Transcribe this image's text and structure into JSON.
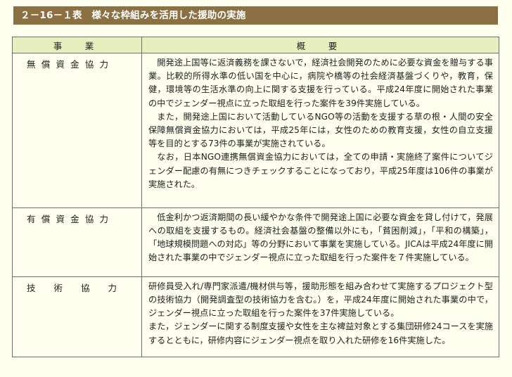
{
  "title": "２－16－１表　様々な枠組みを活用した援助の実施",
  "table": {
    "headers": [
      "事　業",
      "概　要"
    ],
    "rows": [
      {
        "category": "無償資金協力",
        "paragraphs": [
          "開発途上国等に返済義務を課さないで，経済社会開発のために必要な資金を贈与する事業。比較的所得水準の低い国を中心に，病院や橋等の社会経済基盤づくりや，教育，保健，環境等の生活水準の向上に関する支援を行っている。平成24年度に開始された事業の中でジェンダー視点に立った取組を行った案件を39件実施している。",
          "また，開発途上国において活動しているNGO等の活動を支援する草の根・人間の安全保障無償資金協力においては，平成25年には，女性のための教育支援，女性の自立支援等を目的とする73件の事業が実施されている。",
          "なお，日本NGO連携無償資金協力においては，全ての申請・実施終了案件についてジェンダー配慮の有無につきチェックすることになっており，平成25年度は106件の事業が実施された。"
        ]
      },
      {
        "category": "有償資金協力",
        "paragraphs": [
          "低金利かつ返済期間の長い緩やかな条件で開発途上国に必要な資金を貸し付けて，発展への取組を支援するもの。経済社会基盤の整備以外にも，「貧困削減」，「平和の構築」，「地球規模問題への対応」等の分野において事業を実施している。JICAは平成24年度に開始された事業の中でジェンダー視点に立った取組を行った案件を７件実施している。"
        ]
      },
      {
        "category": "技術協力",
        "paragraphs": [
          "研修員受入れ/専門家派遣/機材供与等，援助形態を組み合わせて実施するプロジェクト型の技術協力（開発調査型の技術協力を含む。）を，平成24年度に開始された事業の中で，ジェンダー視点に立った取組を行った案件を37件実施している。",
          "また，ジェンダーに関する制度支援や女性を主な裨益対象とする集団研修24コースを実施するとともに，研修内容にジェンダー視点を取り入れた研修を16件実施した。"
        ]
      }
    ]
  }
}
